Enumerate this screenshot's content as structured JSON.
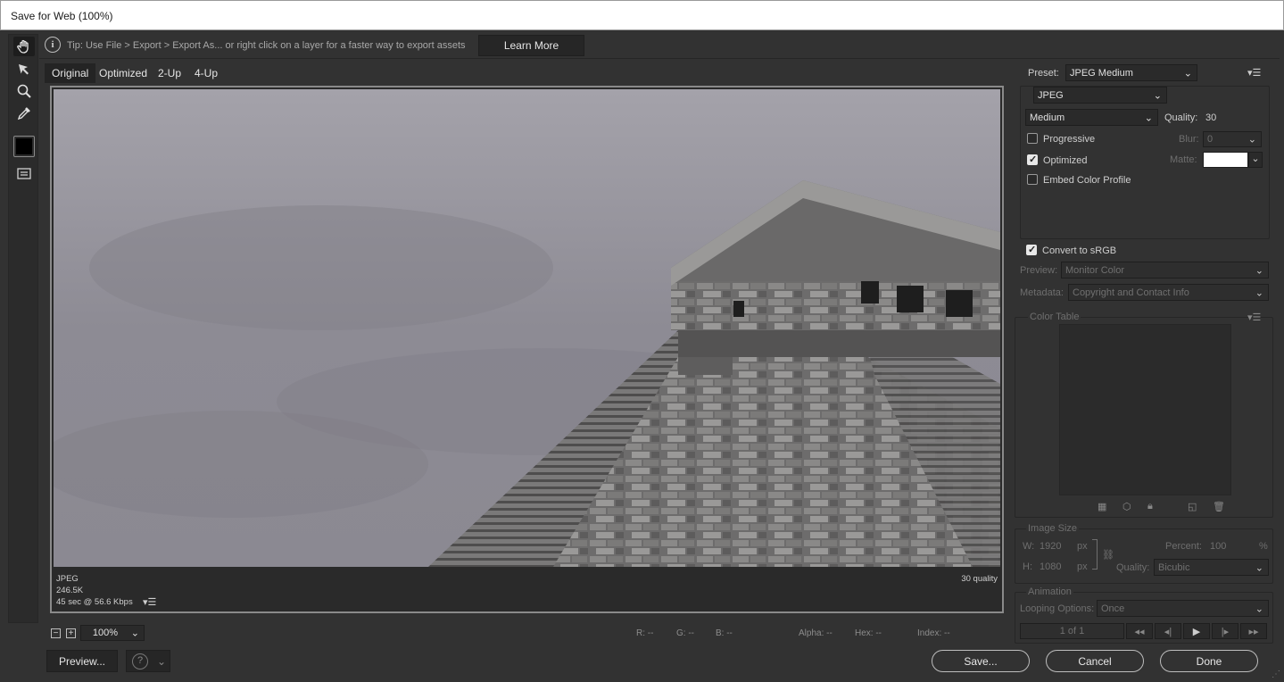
{
  "window": {
    "title": "Save for Web (100%)"
  },
  "tools": {
    "icons": [
      "hand-icon",
      "slice-select-icon",
      "zoom-icon",
      "eyedropper-icon",
      "eyedropper-color-swatch",
      "toggle-slices-icon"
    ],
    "eyedropper_color": "#000000"
  },
  "tip": {
    "text": "Tip: Use File > Export > Export As...  or right click on a layer for a faster way to export assets",
    "learn_more": "Learn More"
  },
  "view_tabs": [
    {
      "label": "Original",
      "active": true
    },
    {
      "label": "Optimized",
      "active": false
    },
    {
      "label": "2-Up",
      "active": false
    },
    {
      "label": "4-Up",
      "active": false
    }
  ],
  "image_info": {
    "format": "JPEG",
    "size": "246.5K",
    "download_time": "45 sec @ 56.6 Kbps",
    "quality_note": "30 quality"
  },
  "zoom": {
    "minus": "−",
    "plus": "+",
    "value": "100%"
  },
  "pixel_readout": {
    "r": "R: --",
    "g": "G: --",
    "b": "B: --",
    "alpha": "Alpha: --",
    "hex": "Hex: --",
    "index": "Index: --"
  },
  "bottom_buttons": {
    "preview": "Preview...",
    "save": "Save...",
    "cancel": "Cancel",
    "done": "Done"
  },
  "settings": {
    "preset_label": "Preset:",
    "preset_value": "JPEG Medium",
    "format_value": "JPEG",
    "quality_level": "Medium",
    "quality_label": "Quality:",
    "quality_value": "30",
    "progressive_label": "Progressive",
    "progressive_checked": false,
    "blur_label": "Blur:",
    "blur_value": "0",
    "optimized_label": "Optimized",
    "optimized_checked": true,
    "matte_label": "Matte:",
    "matte_color": "#ffffff",
    "embed_profile_label": "Embed Color Profile",
    "embed_profile_checked": false,
    "convert_srgb_label": "Convert to sRGB",
    "convert_srgb_checked": true,
    "preview_label": "Preview:",
    "preview_value": "Monitor Color",
    "metadata_label": "Metadata:",
    "metadata_value": "Copyright and Contact Info"
  },
  "color_table": {
    "title": "Color Table",
    "icons": [
      "map-to-web-icon",
      "lock-web-icon",
      "lock-color-icon",
      "new-color-icon",
      "trash-icon"
    ]
  },
  "image_size": {
    "title": "Image Size",
    "w_label": "W:",
    "w_value": "1920",
    "h_label": "H:",
    "h_value": "1080",
    "unit": "px",
    "percent_label": "Percent:",
    "percent_value": "100",
    "percent_unit": "%",
    "quality_label": "Quality:",
    "quality_value": "Bicubic"
  },
  "animation": {
    "title": "Animation",
    "looping_label": "Looping Options:",
    "looping_value": "Once",
    "frame_counter": "1 of 1"
  }
}
